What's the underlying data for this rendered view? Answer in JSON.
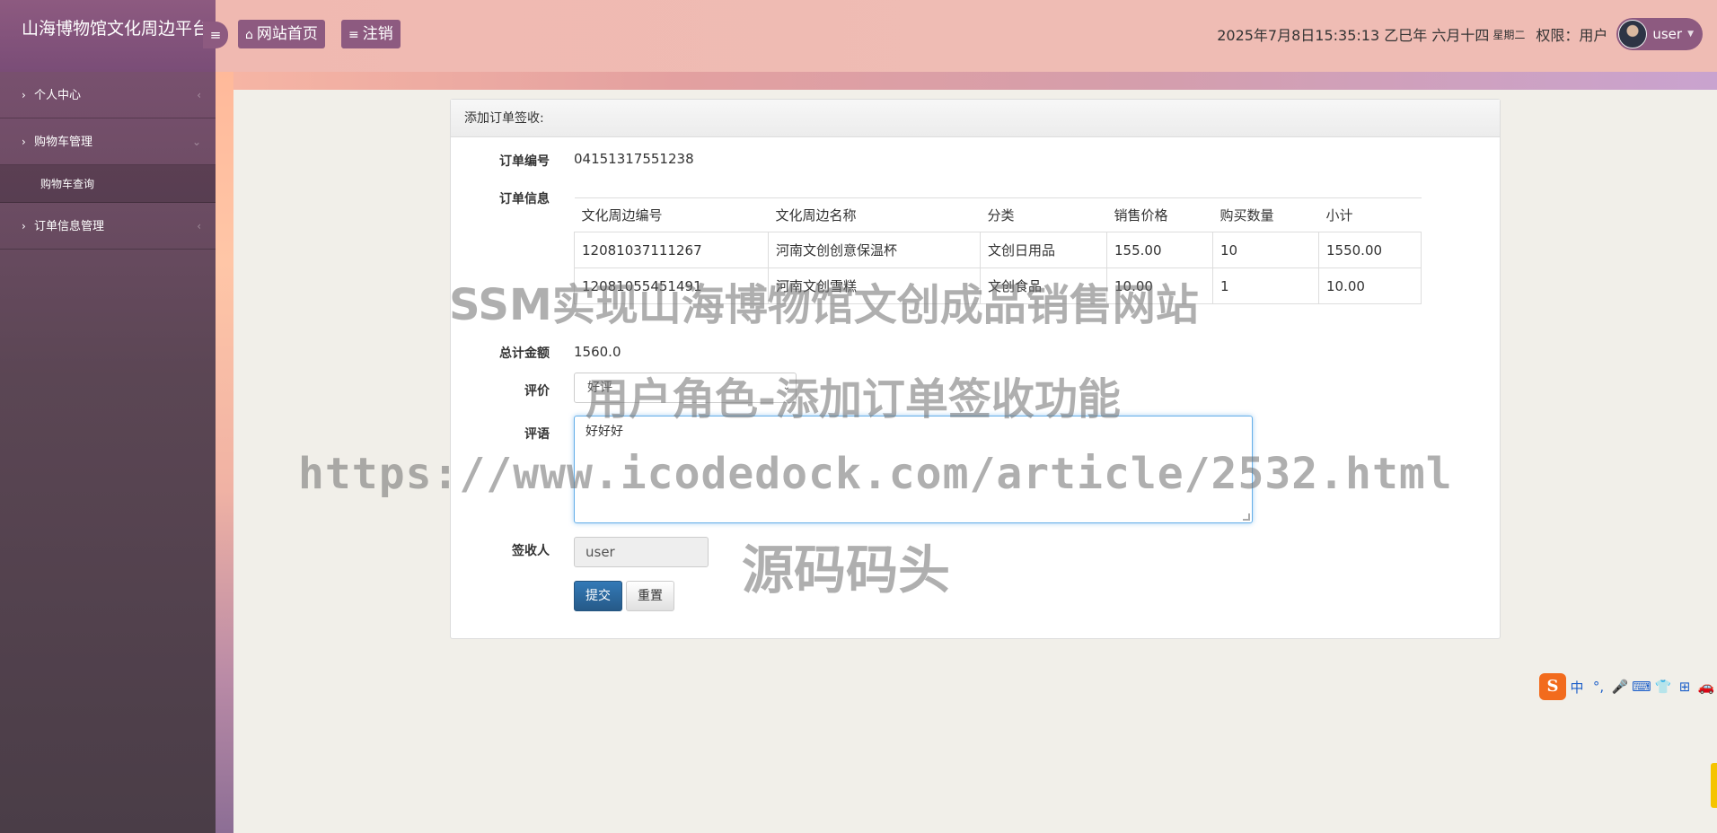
{
  "header": {
    "brand": "山海博物馆文化周边平台",
    "home_button": "网站首页",
    "logout_button": "注销",
    "datetime": "2025年7月8日15:35:13 乙巳年 六月十四",
    "weekday": "星期二",
    "role": "权限：用户",
    "username": "user"
  },
  "sidebar": {
    "items": [
      {
        "label": "个人中心"
      },
      {
        "label": "购物车管理"
      },
      {
        "label": "订单信息管理"
      }
    ],
    "sub_item": "购物车查询"
  },
  "form": {
    "title": "添加订单签收:",
    "order_no_label": "订单编号",
    "order_no": "04151317551238",
    "order_info_label": "订单信息",
    "columns": [
      "文化周边编号",
      "文化周边名称",
      "分类",
      "销售价格",
      "购买数量",
      "小计"
    ],
    "rows": [
      [
        "12081037111267",
        "河南文创创意保温杯",
        "文创日用品",
        "155.00",
        "10",
        "1550.00"
      ],
      [
        "12081055451491",
        "河南文创雪糕",
        "文创食品",
        "10.00",
        "1",
        "10.00"
      ]
    ],
    "total_label": "总计金额",
    "total": "1560.0",
    "rating_label": "评价",
    "rating_value": "好评",
    "comment_label": "评语",
    "comment": "好好好",
    "receiver_label": "签收人",
    "receiver": "user",
    "submit": "提交",
    "reset": "重置"
  },
  "watermark": {
    "line1": "SSM实现山海博物馆文创成品销售网站",
    "line2": "用户角色-添加订单签收功能",
    "line3": "https://www.icodedock.com/article/2532.html",
    "line4": "源码码头"
  },
  "ime": {
    "items": [
      "中",
      "°,",
      "🎤",
      "⌨",
      "👕",
      "⊞",
      "🚗"
    ]
  }
}
